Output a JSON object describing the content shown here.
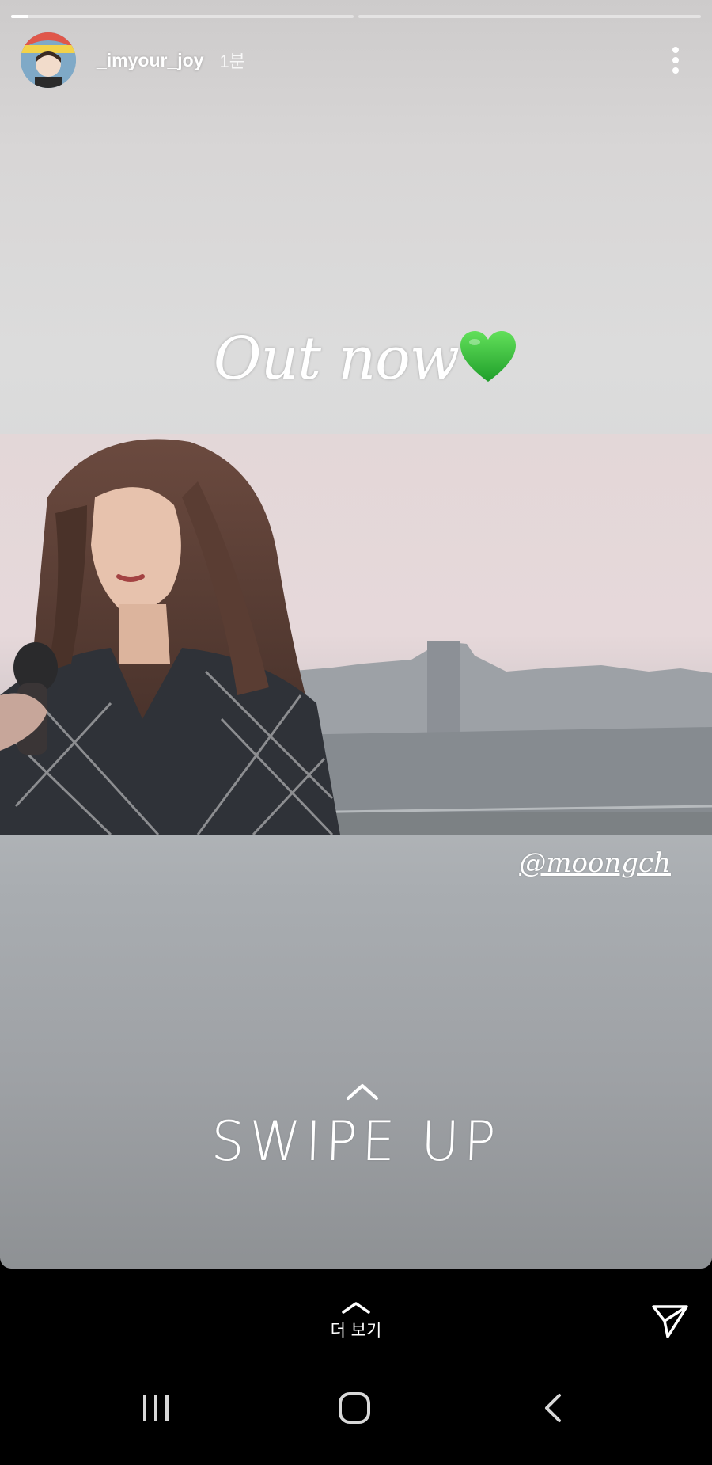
{
  "story": {
    "progress": [
      0.05,
      0.0
    ],
    "user": {
      "username": "_imyour_joy",
      "time": "1분"
    },
    "caption": "Out now",
    "caption_emoji": "green-heart",
    "mention": "@moongch",
    "swipe_up": "SWIPE UP"
  },
  "bottom": {
    "see_more": "더 보기"
  },
  "colors": {
    "heart": "#3cc83c",
    "background": "#000000",
    "text": "#ffffff"
  },
  "icons": {
    "more": "more-vertical-icon",
    "send": "send-icon",
    "recent": "recent-apps-icon",
    "home": "home-icon",
    "back": "back-icon"
  }
}
